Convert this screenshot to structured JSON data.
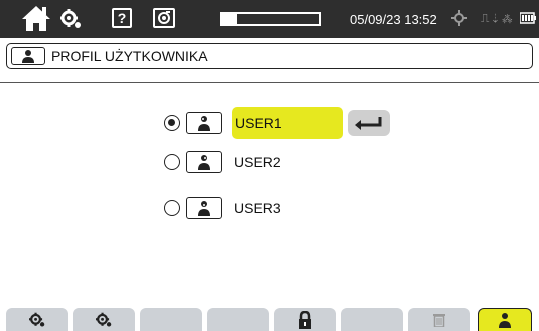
{
  "statusbar": {
    "icons": {
      "home": "home-icon",
      "gear": "gear-icon",
      "help": "help-icon",
      "camera": "camera-icon",
      "gps": "gps-icon",
      "usb": "usb-icon",
      "battery": "battery-icon"
    },
    "help_label": "?",
    "progress_fraction": 0.15,
    "datetime": "05/09/23 13:52",
    "usb_text": "⎍ ⇣ ⁂"
  },
  "header": {
    "title": "PROFIL UŻYTKOWNIKA",
    "icon": "user-profile-icon"
  },
  "users": [
    {
      "label": "USER1",
      "selected": true
    },
    {
      "label": "USER2",
      "selected": false
    },
    {
      "label": "USER3",
      "selected": false
    }
  ],
  "enter_button": {
    "icon": "enter-icon"
  },
  "function_keys": [
    {
      "icon": "gear-icon",
      "active": false
    },
    {
      "icon": "gear-icon",
      "active": false
    },
    {
      "icon": "",
      "active": false
    },
    {
      "icon": "",
      "active": false
    },
    {
      "icon": "lock-icon",
      "active": false
    },
    {
      "icon": "",
      "active": false
    },
    {
      "icon": "trash-icon",
      "active": false
    },
    {
      "icon": "user-profile-icon",
      "active": true
    }
  ],
  "colors": {
    "topbar": "#2e2e2e",
    "highlight": "#e6e81f",
    "function_key": "#cdd1d6",
    "enter_button": "#cfcfcf"
  }
}
